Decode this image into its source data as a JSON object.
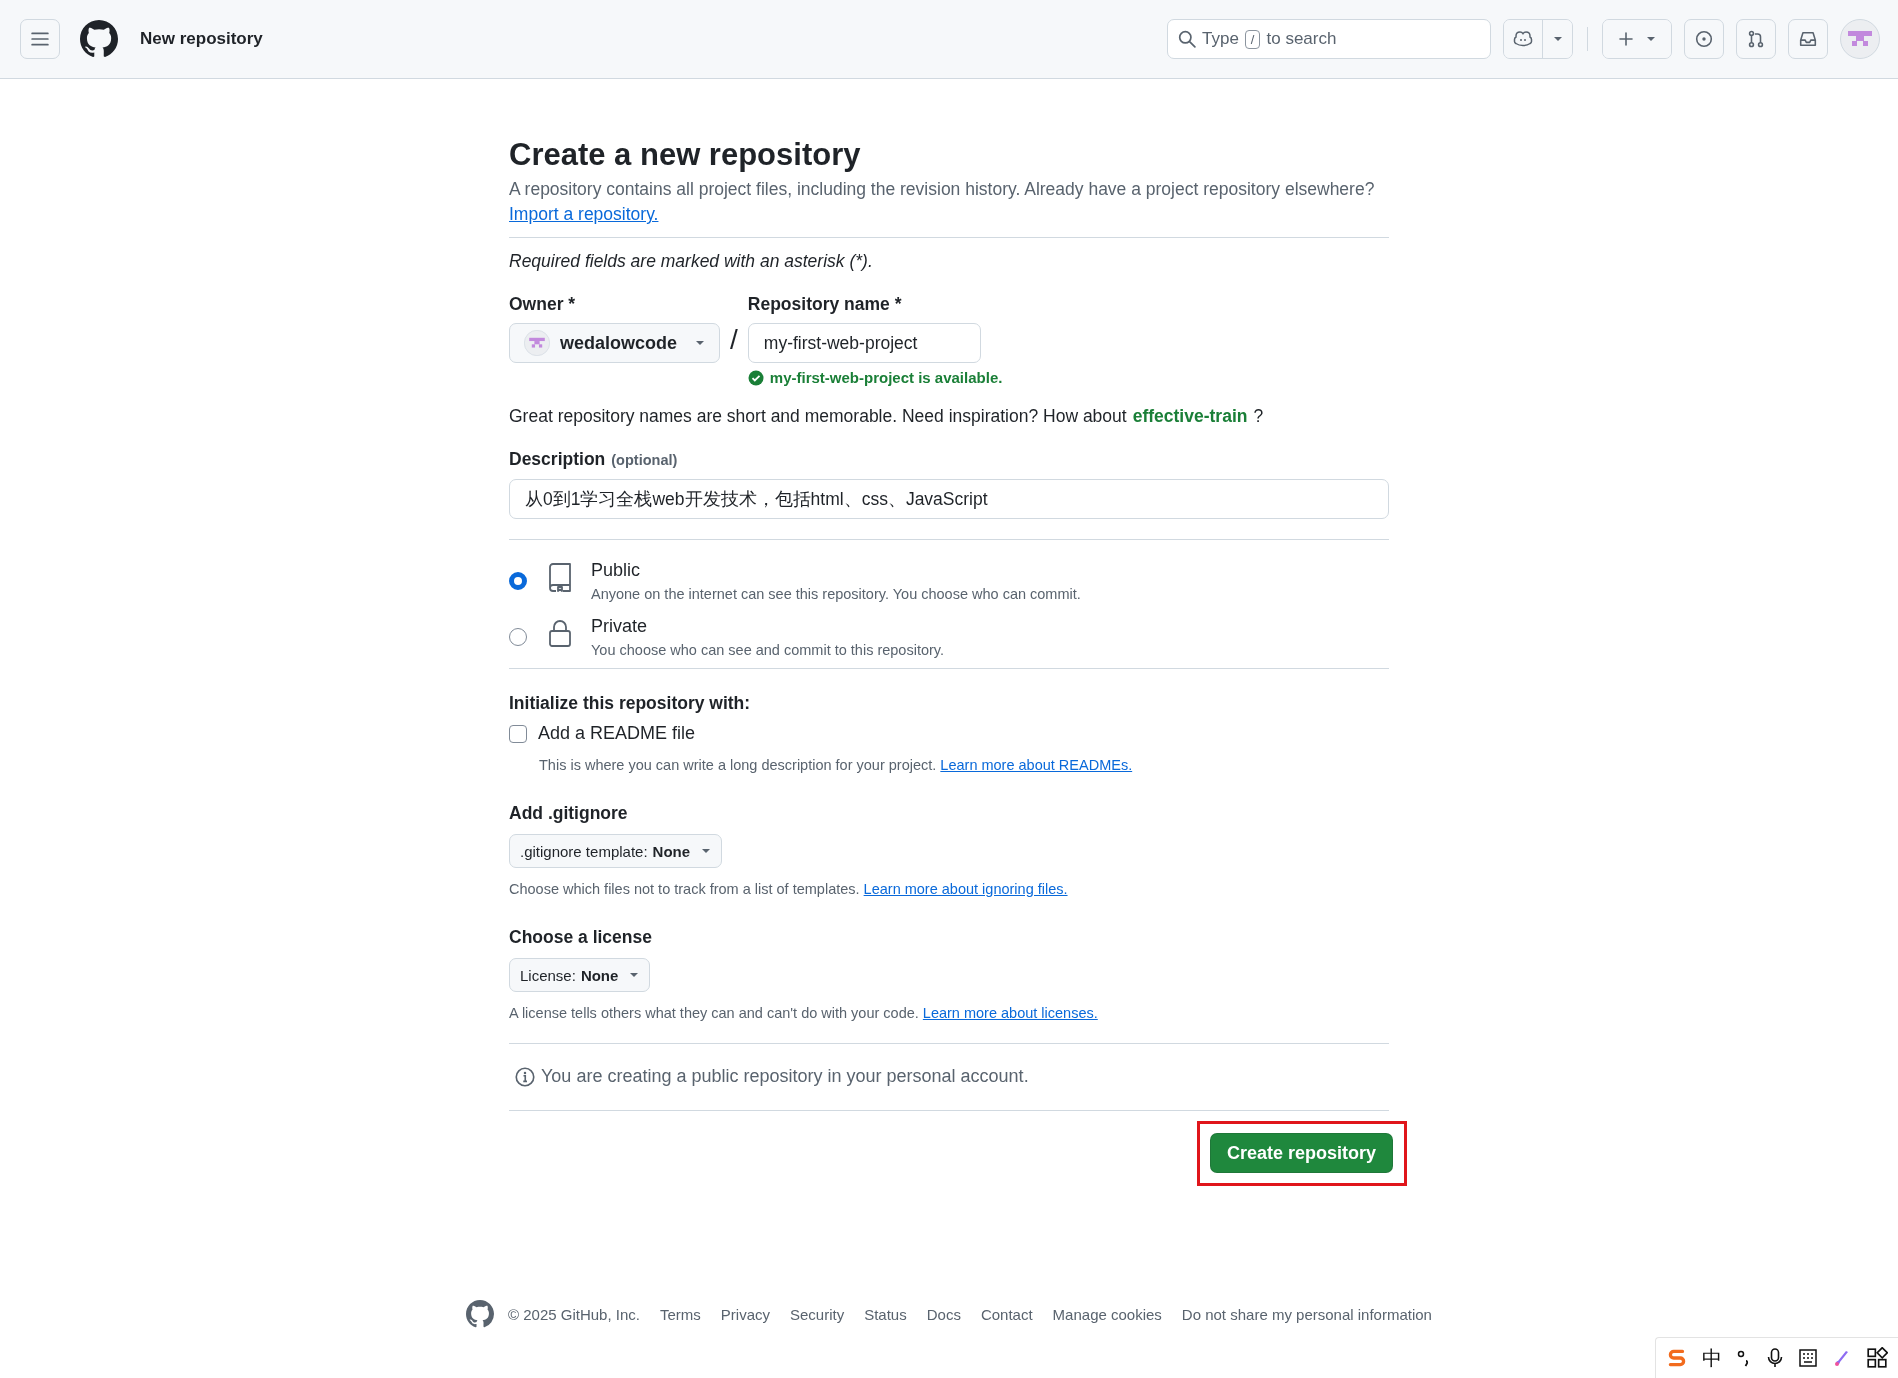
{
  "header": {
    "title": "New repository",
    "search": {
      "prefix": "Type",
      "shortcut_key": "/",
      "suffix": "to search"
    }
  },
  "form": {
    "title": "Create a new repository",
    "intro": "A repository contains all project files, including the revision history. Already have a project repository elsewhere?",
    "import_link": "Import a repository.",
    "required_note": "Required fields are marked with an asterisk (*).",
    "owner": {
      "label": "Owner *",
      "value": "wedalowcode"
    },
    "separator": "/",
    "repo_name": {
      "label": "Repository name *",
      "value": "my-first-web-project",
      "availability": "my-first-web-project is available."
    },
    "suggestion": {
      "text": "Great repository names are short and memorable. Need inspiration? How about",
      "name": "effective-train",
      "after": "?"
    },
    "description": {
      "label": "Description",
      "optional": "(optional)",
      "value": "从0到1学习全栈web开发技术，包括html、css、JavaScript"
    },
    "visibility": [
      {
        "kind": "repo",
        "label": "Public",
        "help": "Anyone on the internet can see this repository. You choose who can commit.",
        "selected": true
      },
      {
        "kind": "lock",
        "label": "Private",
        "help": "You choose who can see and commit to this repository.",
        "selected": false
      }
    ],
    "init": {
      "heading": "Initialize this repository with:",
      "readme": {
        "label": "Add a README file",
        "checked": false,
        "help": "This is where you can write a long description for your project.",
        "link": "Learn more about READMEs."
      }
    },
    "gitignore": {
      "heading": "Add .gitignore",
      "button_label": ".gitignore template:",
      "button_value": "None",
      "help": "Choose which files not to track from a list of templates.",
      "link": "Learn more about ignoring files."
    },
    "license": {
      "heading": "Choose a license",
      "button_label": "License:",
      "button_value": "None",
      "help": "A license tells others what they can and can't do with your code.",
      "link": "Learn more about licenses."
    },
    "notice": "You are creating a public repository in your personal account.",
    "create_button": {
      "label": "Create repository",
      "highlighted": true
    }
  },
  "footer": {
    "copyright": "© 2025 GitHub, Inc.",
    "links": [
      "Terms",
      "Privacy",
      "Security",
      "Status",
      "Docs",
      "Contact",
      "Manage cookies",
      "Do not share my personal information"
    ]
  },
  "ime_toolbar": {
    "mode": "中"
  }
}
